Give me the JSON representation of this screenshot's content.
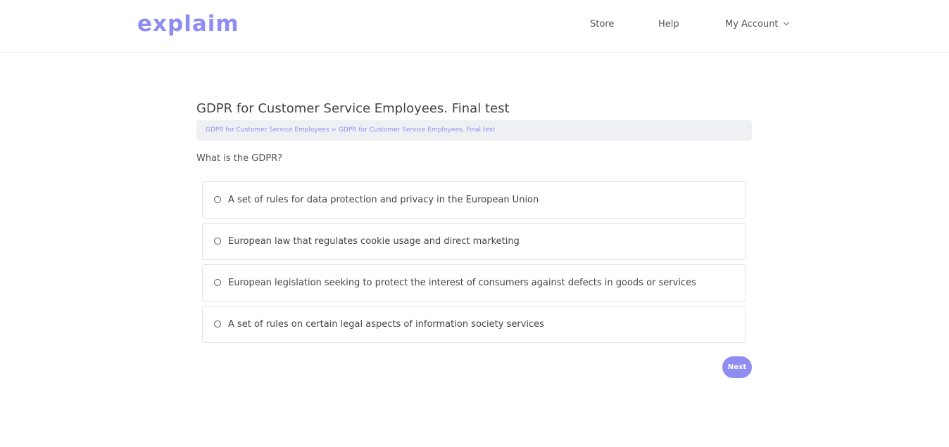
{
  "header": {
    "logo_text": "explaim",
    "nav": {
      "store": "Store",
      "help": "Help",
      "account": "My Account"
    }
  },
  "main": {
    "title": "GDPR for Customer Service Employees. Final test",
    "breadcrumb": {
      "item1": "GDPR for Customer Service Employees",
      "separator": ">",
      "item2": "GDPR for Customer Service Employees. Final test"
    },
    "question": "What is the GDPR?",
    "options": [
      "A set of rules for data protection and privacy in the European Union",
      "European law that regulates cookie usage and direct marketing",
      "European legislation seeking to protect the interest of consumers against defects in goods or services",
      "A set of rules on certain legal aspects of information society services"
    ],
    "next_label": "Next"
  },
  "colors": {
    "accent": "#8f8df2",
    "breadcrumb_bg": "#eef0f4",
    "border": "#dfe2e7"
  },
  "icons": {
    "account_dropdown": "chevron-down-icon",
    "option_selector": "radio-button-icon"
  }
}
